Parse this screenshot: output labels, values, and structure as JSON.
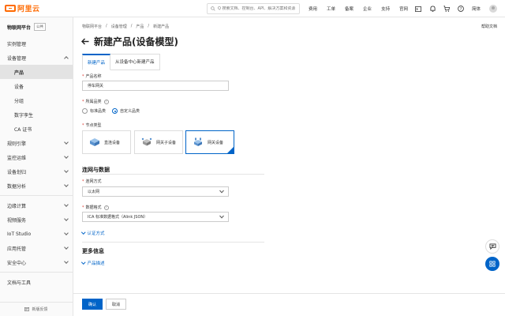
{
  "header": {
    "logo_text": "阿里云",
    "search_placeholder": "Q 搜索文档、控制台、API、解决方案和资源",
    "nav": [
      "费用",
      "工单",
      "备案",
      "企业",
      "支持",
      "官网"
    ],
    "lang": "简体"
  },
  "sidebar": {
    "title": "物联网平台",
    "tag": "公共",
    "items": [
      {
        "label": "实例管理"
      },
      {
        "label": "设备管理"
      },
      {
        "label": "产品"
      },
      {
        "label": "设备"
      },
      {
        "label": "分组"
      },
      {
        "label": "数字孪生"
      },
      {
        "label": "CA 证书"
      },
      {
        "label": "规则引擎"
      },
      {
        "label": "监控运维"
      },
      {
        "label": "设备划归"
      },
      {
        "label": "数据分析"
      },
      {
        "label": "边缘计算"
      },
      {
        "label": "视频服务"
      },
      {
        "label": "IoT Studio"
      },
      {
        "label": "应用托管"
      },
      {
        "label": "安全中心"
      },
      {
        "label": "文档与工具"
      }
    ],
    "feedback": "新版反馈"
  },
  "breadcrumb": [
    "物联网平台",
    "/",
    "设备管理",
    "/",
    "产品",
    "/",
    "新建产品"
  ],
  "help_doc": "帮助文档",
  "page_title": "新建产品(设备模型)",
  "tabs": [
    "新建产品",
    "从设备中心新建产品"
  ],
  "form": {
    "product_name_label": "产品名称",
    "product_name_value": "停车网关",
    "category_label": "所属品类",
    "category_options": [
      "标准品类",
      "自定义品类"
    ],
    "node_type_label": "节点类型",
    "node_types": [
      "直连设备",
      "网关子设备",
      "网关设备"
    ],
    "network_section": "连网与数据",
    "connect_label": "连网方式",
    "connect_value": "以太网",
    "data_format_label": "数据格式",
    "data_format_value": "ICA 标准数据格式（Alink JSON）",
    "auth_expander": "认证方式",
    "more_section": "更多信息",
    "desc_expander": "产品描述"
  },
  "footer": {
    "confirm": "确认",
    "cancel": "取消"
  },
  "colors": {
    "brand": "#ff6a00",
    "primary": "#0064c8"
  }
}
